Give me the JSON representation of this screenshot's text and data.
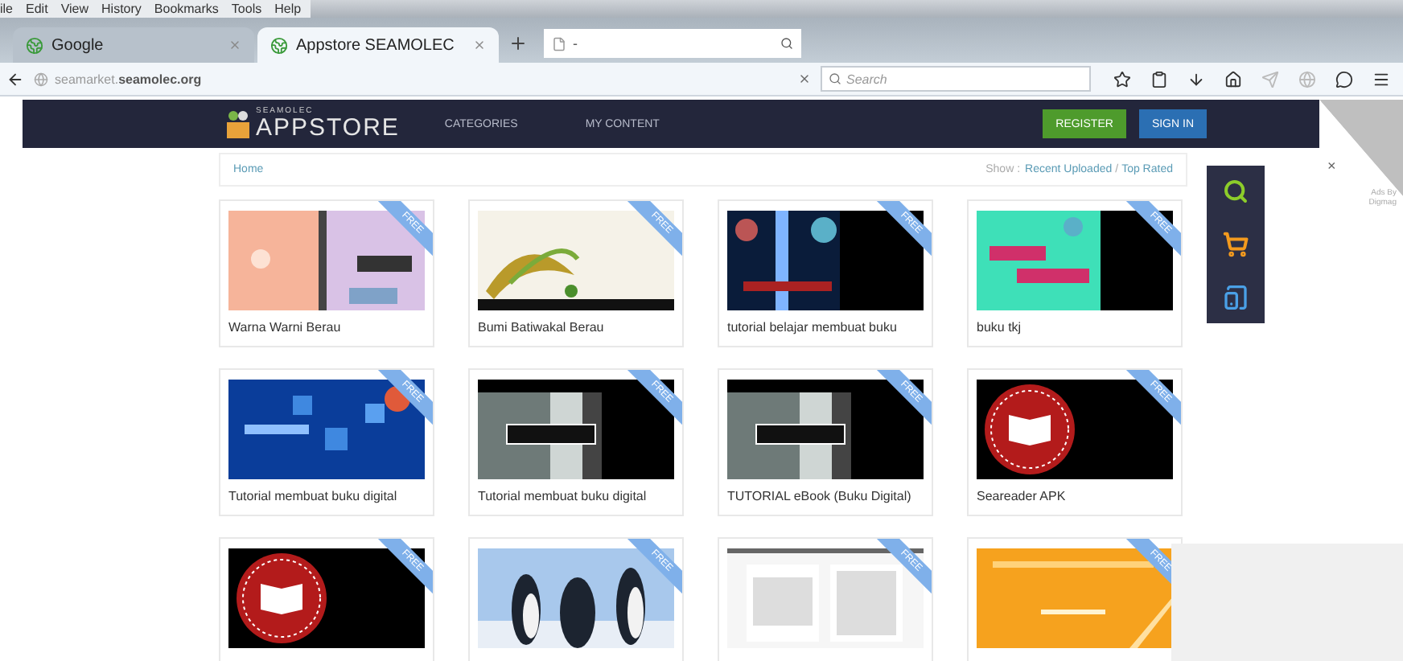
{
  "menu_bar": [
    "ile",
    "Edit",
    "View",
    "History",
    "Bookmarks",
    "Tools",
    "Help"
  ],
  "tabs": [
    {
      "title": "Google",
      "selected": false
    },
    {
      "title": "Appstore SEAMOLEC",
      "selected": true
    }
  ],
  "tab_search": {
    "value": "-"
  },
  "address_bar": {
    "host_prefix": "seamarket.",
    "host": "seamolec.org"
  },
  "search_field": {
    "placeholder": "Search"
  },
  "site": {
    "logo_small": "SEAMOLEC",
    "logo_big": "APPSTORE",
    "nav": [
      "CATEGORIES",
      "MY CONTENT"
    ],
    "buttons": [
      {
        "label": "REGISTER",
        "kind": "green"
      },
      {
        "label": "SIGN IN",
        "kind": "blue"
      }
    ]
  },
  "breadcrumb": "Home",
  "show_label": "Show :",
  "sort_links": [
    "Recent Uploaded",
    "Top Rated"
  ],
  "sort_separator": "/",
  "cards": [
    {
      "title": "Warna Warni Berau",
      "badge": "FREE"
    },
    {
      "title": "Bumi Batiwakal Berau",
      "badge": "FREE"
    },
    {
      "title": "tutorial belajar membuat buku",
      "badge": "FREE"
    },
    {
      "title": "buku tkj",
      "badge": "FREE"
    },
    {
      "title": "Tutorial membuat buku digital",
      "badge": "FREE"
    },
    {
      "title": "Tutorial membuat buku digital",
      "badge": "FREE"
    },
    {
      "title": "TUTORIAL eBook (Buku Digital)",
      "badge": "FREE"
    },
    {
      "title": "Seareader APK",
      "badge": "FREE"
    },
    {
      "badge": "FREE"
    },
    {
      "badge": "FREE"
    },
    {
      "badge": "FREE"
    },
    {
      "badge": "FREE"
    }
  ],
  "ad_corner": {
    "close": "×",
    "caption": "Ads By Digmag"
  }
}
